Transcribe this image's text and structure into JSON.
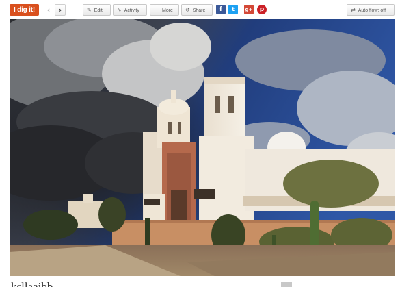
{
  "toolbar": {
    "dig_label": "I dig it!",
    "prev_icon": "chevron-left-icon",
    "next_icon": "chevron-right-icon",
    "edit_label": "Edit",
    "activity_label": "Activity",
    "more_label": "More",
    "share_label": "Share",
    "auto_flow_label": "Auto flow: off"
  },
  "social": {
    "facebook": "f",
    "twitter": "t",
    "googleplus": "g+",
    "pinterest": "p"
  },
  "colors": {
    "dig_button": "#d9501e",
    "facebook": "#3b5998",
    "twitter": "#1da1f2",
    "googleplus": "#d34836",
    "pinterest": "#cb2027"
  },
  "photo": {
    "subject": "mission-church-photo"
  },
  "caption": {
    "title": "ksllaaibb"
  }
}
